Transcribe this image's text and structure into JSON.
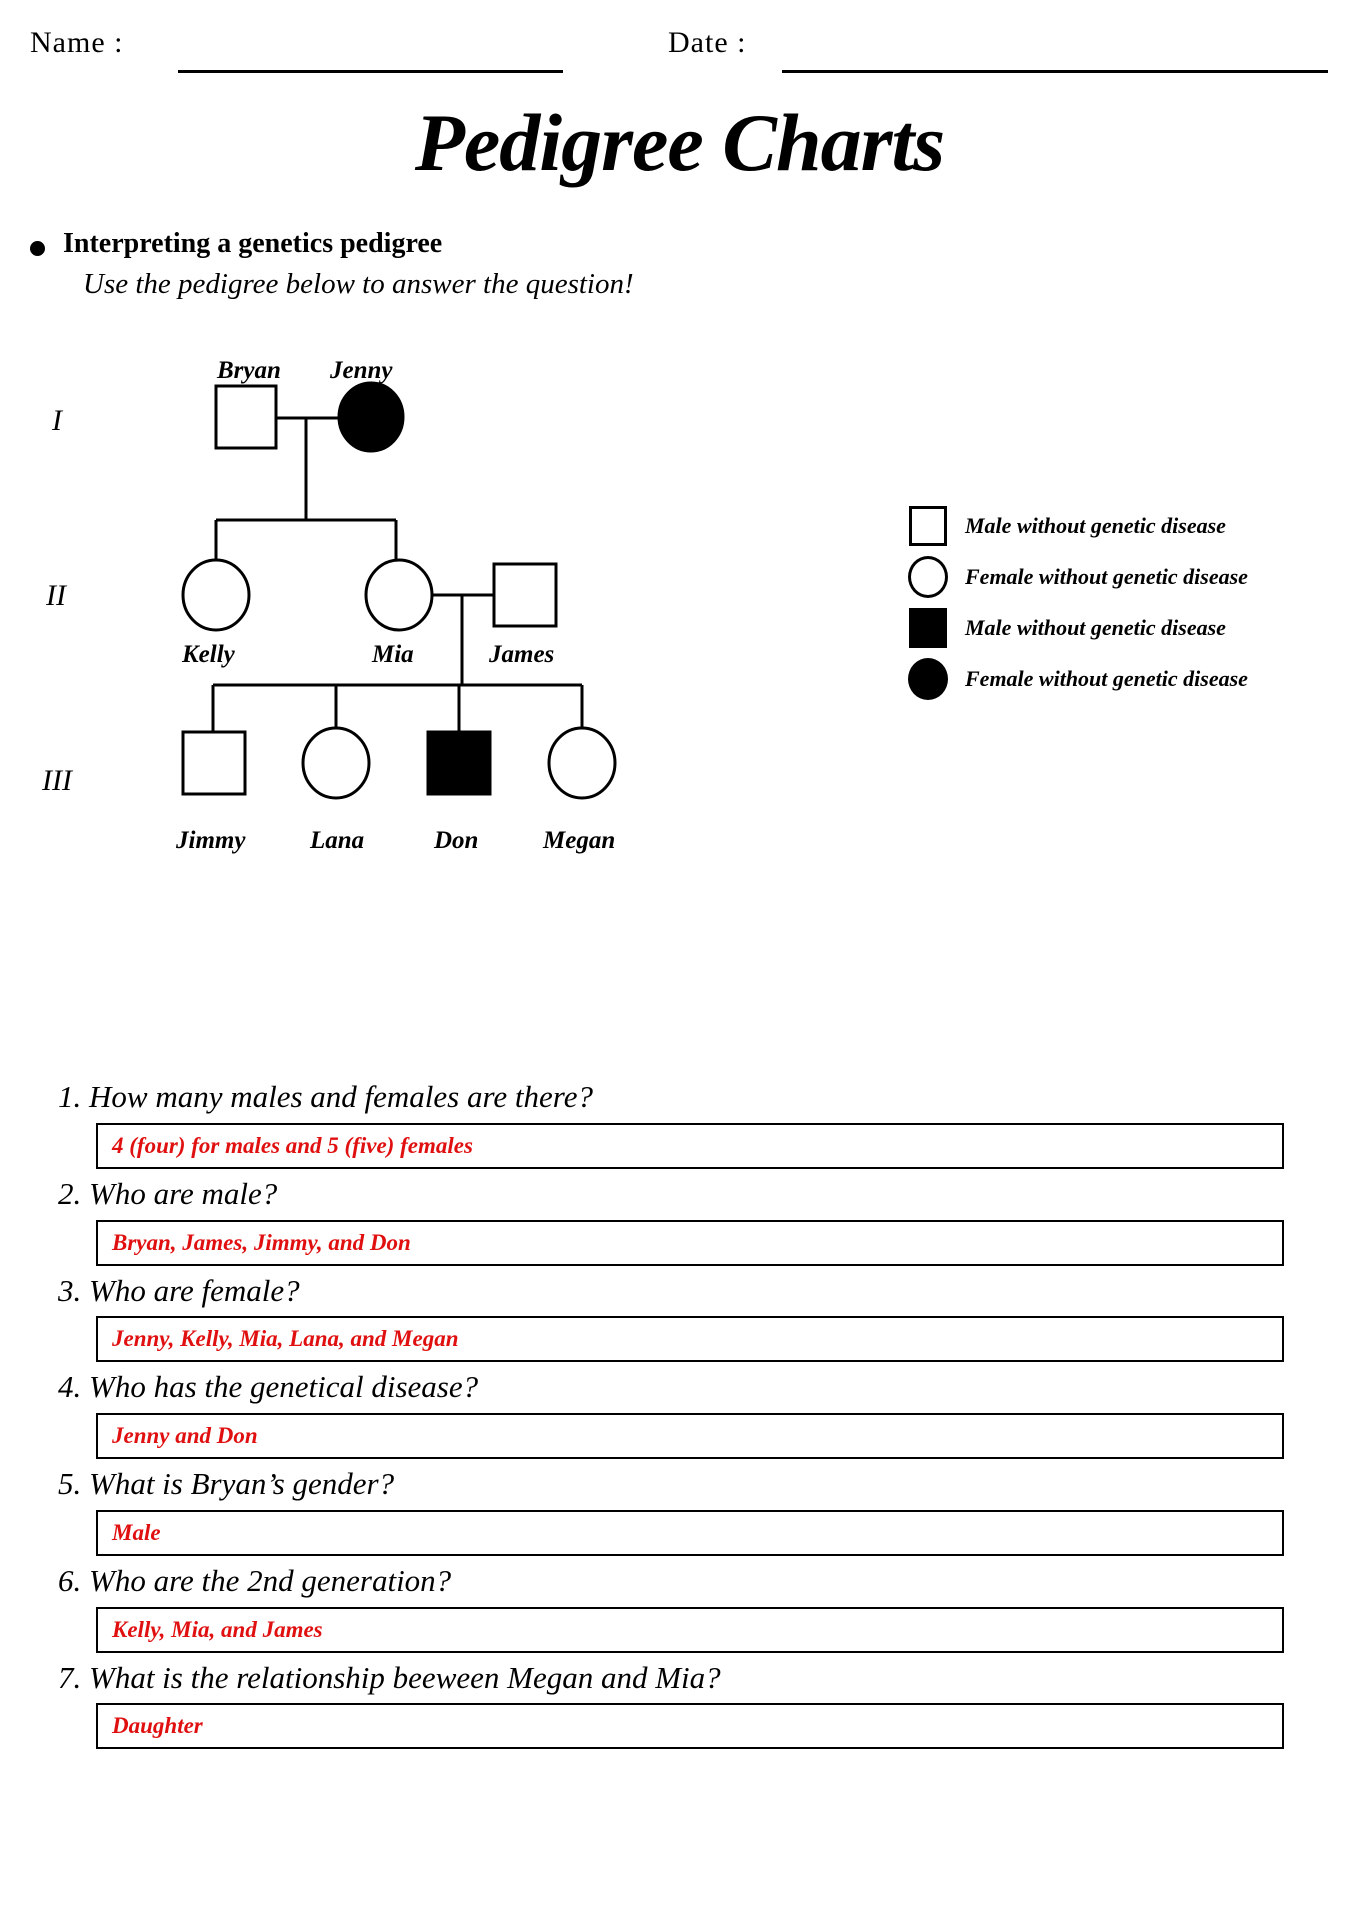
{
  "header": {
    "name_label": "Name :",
    "date_label": "Date   :",
    "name_value": "",
    "date_value": ""
  },
  "title": "Pedigree Charts",
  "instructions": {
    "bullet": "Interpreting a genetics pedigree",
    "subtitle": "Use the pedigree below to answer the question!"
  },
  "pedigree": {
    "generation_labels": [
      "I",
      "II",
      "III"
    ],
    "individuals": [
      {
        "name": "Bryan",
        "sex": "male",
        "shape": "square",
        "affected": false,
        "generation": "I"
      },
      {
        "name": "Jenny",
        "sex": "female",
        "shape": "circle",
        "affected": true,
        "generation": "I"
      },
      {
        "name": "Kelly",
        "sex": "female",
        "shape": "circle",
        "affected": false,
        "generation": "II"
      },
      {
        "name": "Mia",
        "sex": "female",
        "shape": "circle",
        "affected": false,
        "generation": "II"
      },
      {
        "name": "James",
        "sex": "male",
        "shape": "square",
        "affected": false,
        "generation": "II"
      },
      {
        "name": "Jimmy",
        "sex": "male",
        "shape": "square",
        "affected": false,
        "generation": "III"
      },
      {
        "name": "Lana",
        "sex": "female",
        "shape": "circle",
        "affected": false,
        "generation": "III"
      },
      {
        "name": "Don",
        "sex": "male",
        "shape": "square",
        "affected": true,
        "generation": "III"
      },
      {
        "name": "Megan",
        "sex": "female",
        "shape": "circle",
        "affected": false,
        "generation": "III"
      }
    ]
  },
  "legend": {
    "items": [
      {
        "symbol": "open-square",
        "label": "Male without genetic disease"
      },
      {
        "symbol": "open-circle",
        "label": "Female without genetic disease"
      },
      {
        "symbol": "filled-square",
        "label": "Male without genetic disease"
      },
      {
        "symbol": "filled-circle",
        "label": "Female without genetic disease"
      }
    ]
  },
  "questions": [
    {
      "number": "1.",
      "text": "1. How many males and females are there?",
      "answer": "4 (four) for males and 5 (five) females"
    },
    {
      "number": "2.",
      "text": "2. Who are male?",
      "answer": "Bryan, James, Jimmy, and Don"
    },
    {
      "number": "3.",
      "text": "3. Who are female?",
      "answer": "Jenny, Kelly, Mia, Lana, and Megan"
    },
    {
      "number": "4.",
      "text": "4. Who has the genetical disease?",
      "answer": "Jenny and Don"
    },
    {
      "number": "5.",
      "text": "5. What is Bryan’s gender?",
      "answer": "Male"
    },
    {
      "number": "6.",
      "text": "6. Who are the 2nd generation?",
      "answer": "Kelly, Mia, and James"
    },
    {
      "number": "7.",
      "text": "7. What is the relationship beeween Megan and Mia?",
      "answer": "Daughter"
    }
  ],
  "colors": {
    "ink": "#000000",
    "answer_red": "#e01010",
    "paper": "#ffffff"
  }
}
